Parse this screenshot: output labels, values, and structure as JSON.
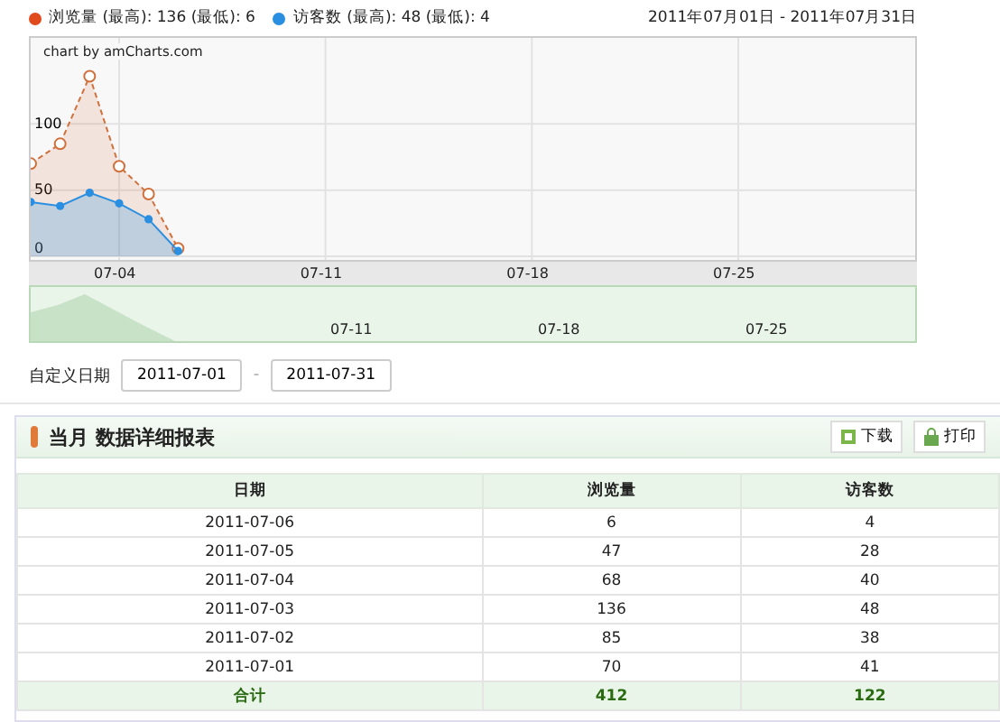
{
  "legend": [
    {
      "label": "浏览量 (最高): 136 (最低): 6",
      "color": "#e04a1c"
    },
    {
      "label": "访客数 (最高): 48 (最低): 4",
      "color": "#2a8fe0"
    }
  ],
  "date_range": "2011年07月01日 - 2011年07月31日",
  "chart": {
    "credit": "chart by amCharts.com",
    "chart_data": {
      "type": "area",
      "categories": [
        null,
        null,
        null,
        "07-04",
        null,
        null,
        null,
        null,
        null,
        null,
        "07-11",
        null,
        null,
        null,
        null,
        null,
        null,
        "07-18",
        null,
        null,
        null,
        null,
        null,
        null,
        "07-25",
        null,
        null,
        null,
        null,
        null,
        null
      ],
      "series": [
        {
          "color": "#d0703c",
          "values": [
            70,
            85,
            136,
            68,
            47,
            6,
            null,
            null,
            null,
            null,
            null,
            null,
            null,
            null,
            null,
            null,
            null,
            null,
            null,
            null,
            null,
            null,
            null,
            null,
            null,
            null,
            null,
            null,
            null,
            null,
            null
          ]
        },
        {
          "color": "#2a8fe0",
          "values": [
            41,
            38,
            48,
            40,
            28,
            4,
            null,
            null,
            null,
            null,
            null,
            null,
            null,
            null,
            null,
            null,
            null,
            null,
            null,
            null,
            null,
            null,
            null,
            null,
            null,
            null,
            null,
            null,
            null,
            null,
            null
          ]
        }
      ],
      "ylim": [
        0,
        165
      ],
      "yticks": [
        0,
        50,
        100
      ],
      "grid": true
    }
  },
  "overview": {
    "labels": [
      "07-11",
      "07-18",
      "07-25"
    ]
  },
  "custom_date": {
    "label": "自定义日期",
    "from": "2011-07-01",
    "separator": "-",
    "to": "2011-07-31"
  },
  "report": {
    "title": "当月 数据详细报表",
    "buttons": [
      "下载",
      "打印"
    ],
    "columns": [
      "日期",
      "浏览量",
      "访客数"
    ],
    "rows": [
      [
        "2011-07-06",
        "6",
        "4"
      ],
      [
        "2011-07-05",
        "47",
        "28"
      ],
      [
        "2011-07-04",
        "68",
        "40"
      ],
      [
        "2011-07-03",
        "136",
        "48"
      ],
      [
        "2011-07-02",
        "85",
        "38"
      ],
      [
        "2011-07-01",
        "70",
        "41"
      ]
    ],
    "total": [
      "合计",
      "412",
      "122"
    ]
  }
}
